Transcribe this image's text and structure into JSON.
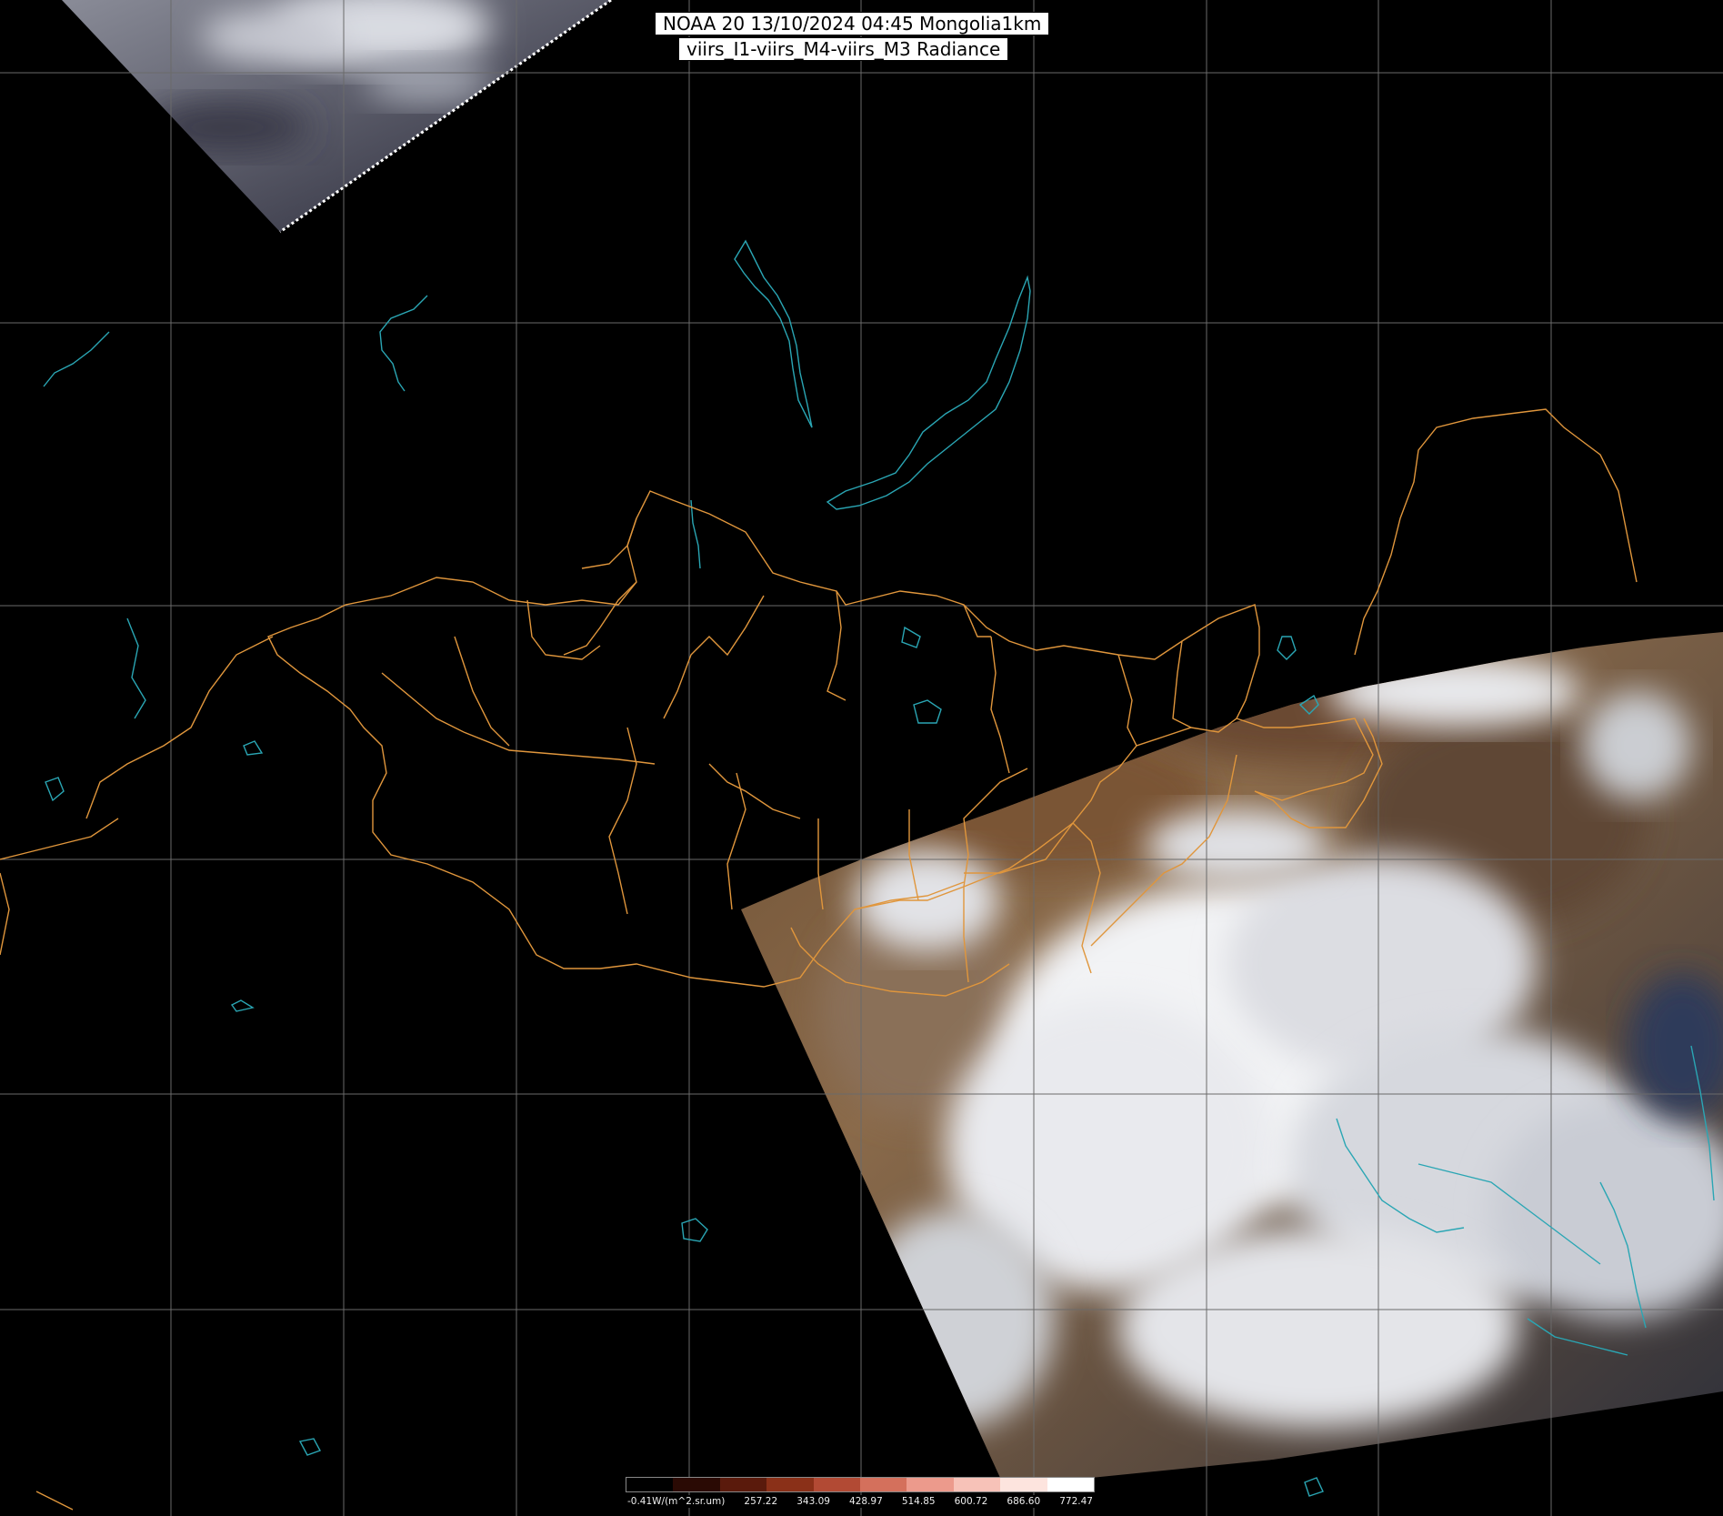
{
  "header": {
    "line1": "NOAA 20 13/10/2024 04:45 Mongolia1km",
    "line2": "viirs_I1-viirs_M4-viirs_M3 Radiance"
  },
  "legend": {
    "labels": [
      "-0.41W/(m^2.sr.um)",
      "257.22",
      "343.09",
      "428.97",
      "514.85",
      "600.72",
      "686.60",
      "772.47"
    ],
    "colors": [
      "#000000",
      "#2a0a04",
      "#5a1a0c",
      "#8a3018",
      "#b24a34",
      "#d4705c",
      "#ec9a8c",
      "#f7c2b8",
      "#fde4de",
      "#ffffff"
    ]
  },
  "colors": {
    "grid": "#6a6a6a",
    "borders": "#e0963c",
    "water": "#2aa6b4",
    "background": "#000000"
  }
}
